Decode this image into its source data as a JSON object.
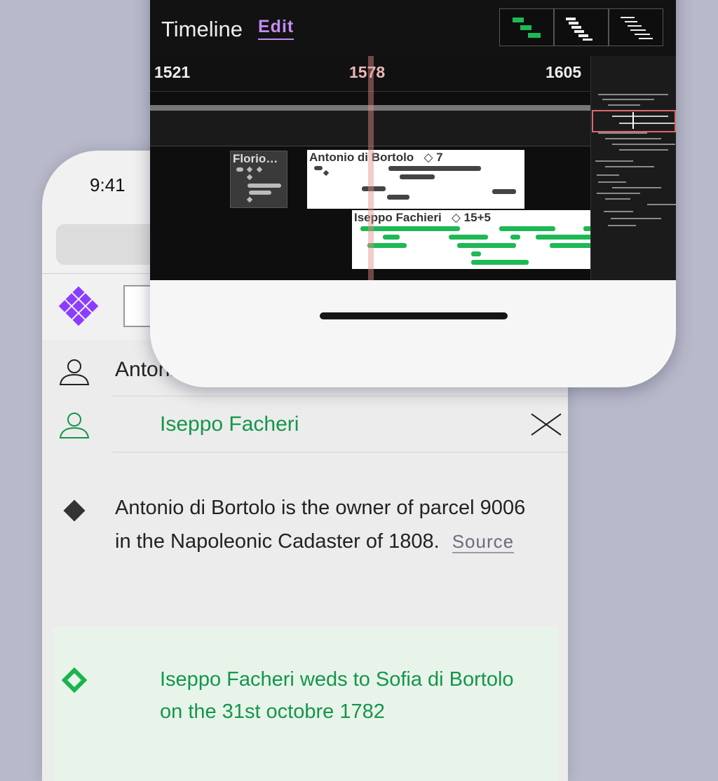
{
  "status_bar": {
    "time": "9:41"
  },
  "people": [
    {
      "name": "Antonio di Bortolo",
      "color": "#222222"
    },
    {
      "name": "Iseppo Facheri",
      "color": "#14964a"
    }
  ],
  "facts": [
    {
      "text": "Antonio di Bortolo is the owner of parcel 9006 in the Napoleonic Cadaster of 1808.",
      "link": "Source"
    },
    {
      "text": "Iseppo Facheri weds to Sofia di Bortolo on the 31st octobre 1782"
    }
  ],
  "timeline": {
    "title": "Timeline",
    "edit_label": "Edit",
    "years": [
      "1521",
      "1578",
      "1605"
    ],
    "cards": [
      {
        "title": "Florio…",
        "badge": ""
      },
      {
        "title": "Antonio di Bortolo",
        "badge": "◇ 7"
      },
      {
        "title": "Iseppo Fachieri",
        "badge": "◇ 15+5"
      }
    ],
    "accent": "#c38cf2",
    "green": "#1db954"
  }
}
